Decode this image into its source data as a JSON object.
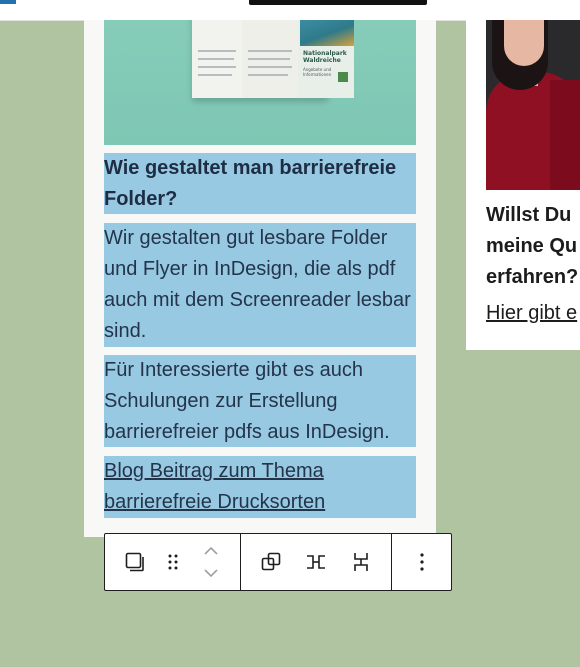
{
  "left_card": {
    "brochure": {
      "title_line1": "Nationalpark",
      "title_line2": "Waldreiche",
      "subtitle_line1": "Angebote und",
      "subtitle_line2": "Informationen"
    },
    "heading": "Wie gestaltet man barrierefreie Folder?",
    "paragraph1": "Wir gestalten gut lesbare Folder und Flyer in InDesign, die als pdf auch mit dem Screenreader lesbar sind.",
    "paragraph2": "Für Interessierte gibt es auch Schulungen zur Erstellung barrierefreier pdfs aus InDesign.",
    "link_text": "Blog Beitrag zum Thema barrierefreie Drucksorten"
  },
  "right_card": {
    "title_lines": [
      "Willst Du",
      "meine Qu",
      "erfahren?"
    ],
    "link_text": "Hier gibt e"
  },
  "toolbar": {
    "icons": [
      "block-type-icon",
      "drag-handle-icon",
      "move-up-icon",
      "move-down-icon",
      "duplicate-icon",
      "justify-horizontal-icon",
      "justify-vertical-icon",
      "more-options-icon"
    ]
  },
  "colors": {
    "background": "#b0c4a2",
    "selection": "#98c9e2",
    "text": "#24344a",
    "image_bg": "#7ec7b4"
  }
}
